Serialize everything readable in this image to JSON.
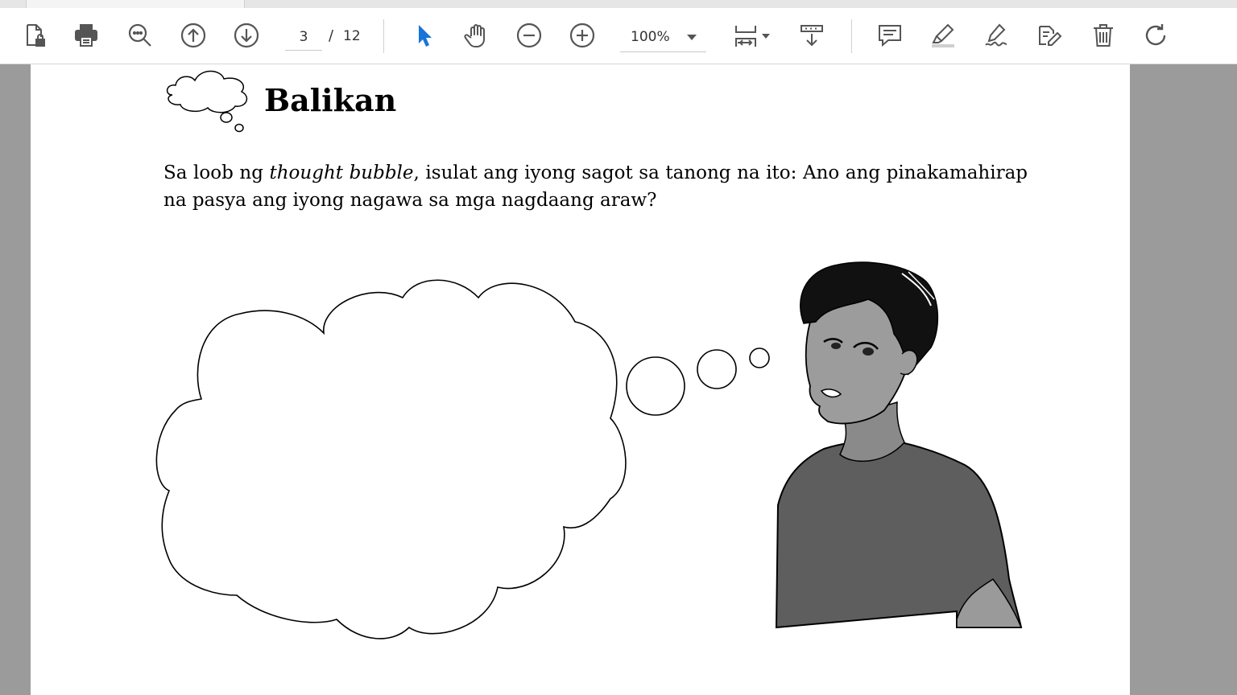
{
  "toolbar": {
    "current_page": "3",
    "page_separator": "/",
    "total_pages": "12",
    "zoom": "100%",
    "icons": [
      "file-lock-icon",
      "print-icon",
      "find-icon",
      "page-up-icon",
      "page-down-icon",
      "select-arrow-icon",
      "hand-icon",
      "zoom-out-icon",
      "zoom-in-icon",
      "page-fit-icon",
      "scroll-mode-icon",
      "comment-icon",
      "highlight-icon",
      "sign-icon",
      "edit-icon",
      "delete-icon",
      "rotate-icon"
    ],
    "accent_color": "#1a73d9"
  },
  "document": {
    "section_title": "Balikan",
    "instruction_part1": "Sa loob ng ",
    "instruction_italic": "thought bubble",
    "instruction_part2": ", isulat ang iyong sagot sa tanong na ito:  Ano ang pinakamahirap na pasya ang iyong nagawa sa mga nagdaang araw?"
  }
}
